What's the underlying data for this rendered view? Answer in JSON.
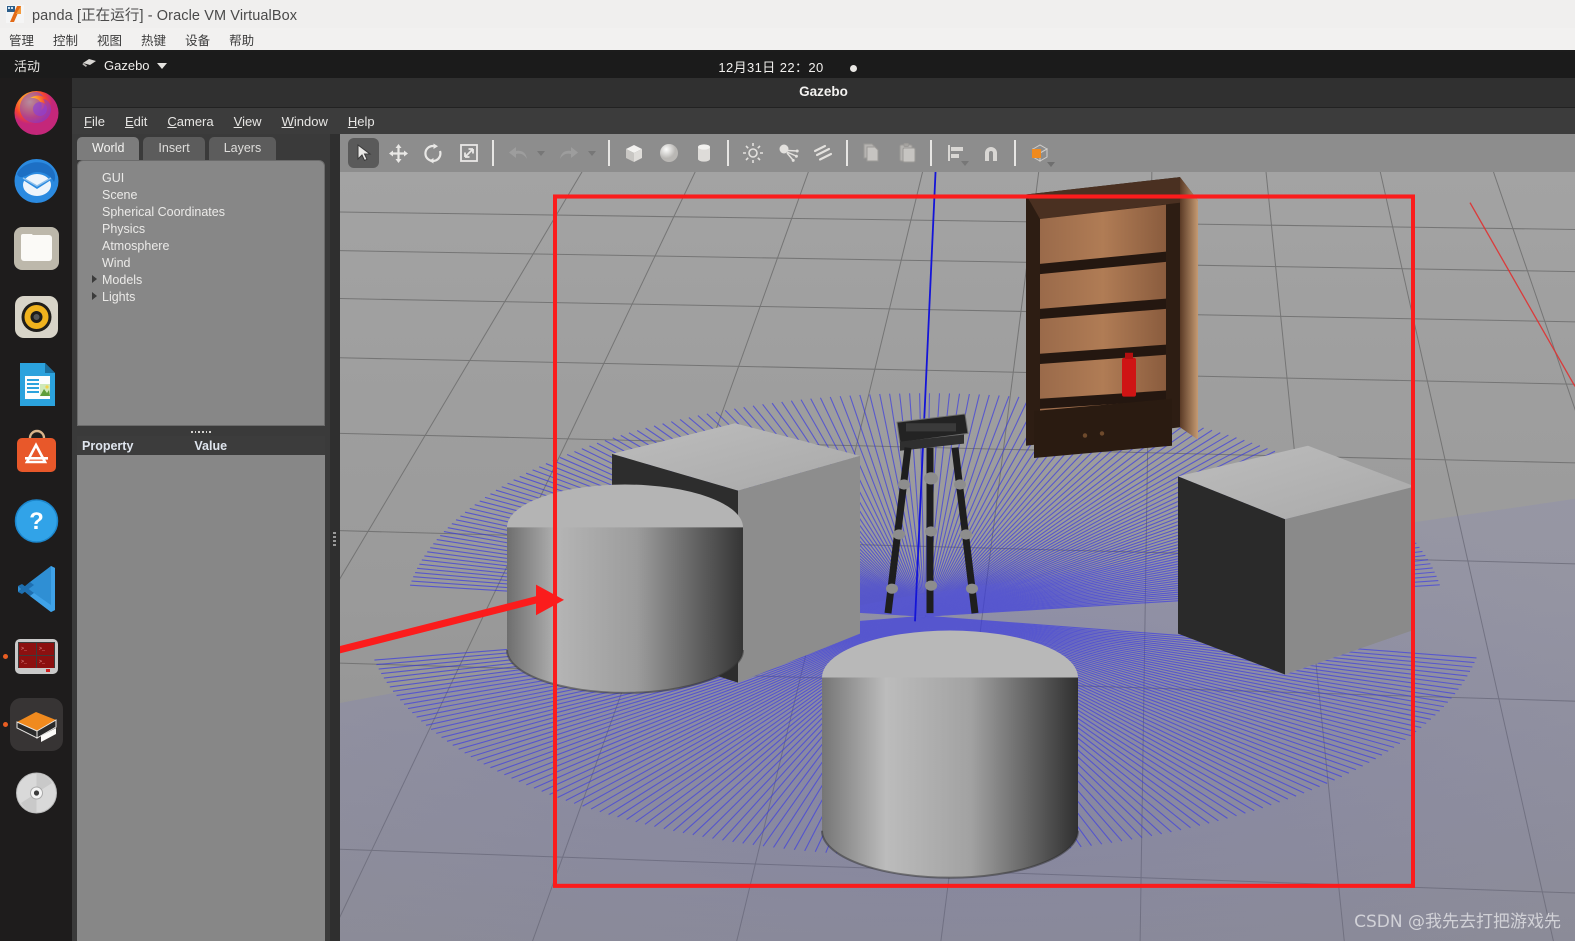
{
  "host_window": {
    "title": "panda [正在运行] - Oracle VM VirtualBox",
    "icon": "virtualbox-icon",
    "menus": [
      "管理",
      "控制",
      "视图",
      "热键",
      "设备",
      "帮助"
    ]
  },
  "shell": {
    "activities": "活动",
    "app_menu_label": "Gazebo",
    "app_menu_icon": "gazebo-icon",
    "clock": "12月31日  22：20",
    "dock": [
      {
        "name": "firefox",
        "label": "Firefox",
        "active": false
      },
      {
        "name": "thunderbird",
        "label": "Thunderbird",
        "active": false
      },
      {
        "name": "files",
        "label": "Files",
        "active": false
      },
      {
        "name": "rhythmbox",
        "label": "Rhythmbox",
        "active": false
      },
      {
        "name": "libreoffice-writer",
        "label": "LibreOffice Writer",
        "active": false
      },
      {
        "name": "ubuntu-software",
        "label": "Ubuntu Software",
        "active": false
      },
      {
        "name": "help",
        "label": "Help",
        "active": false
      },
      {
        "name": "vscode",
        "label": "Visual Studio Code",
        "active": false
      },
      {
        "name": "terminator",
        "label": "Terminator",
        "active": true
      },
      {
        "name": "gazebo",
        "label": "Gazebo",
        "active": true
      },
      {
        "name": "disc",
        "label": "Disc Image",
        "active": false
      }
    ]
  },
  "gazebo": {
    "title": "Gazebo",
    "menus": [
      {
        "label": "File",
        "accel": "F"
      },
      {
        "label": "Edit",
        "accel": "E"
      },
      {
        "label": "Camera",
        "accel": "C"
      },
      {
        "label": "View",
        "accel": "V"
      },
      {
        "label": "Window",
        "accel": "W"
      },
      {
        "label": "Help",
        "accel": "H"
      }
    ],
    "tabs": [
      {
        "label": "World",
        "active": true
      },
      {
        "label": "Insert",
        "active": false
      },
      {
        "label": "Layers",
        "active": false
      }
    ],
    "tree": [
      {
        "label": "GUI",
        "expandable": false
      },
      {
        "label": "Scene",
        "expandable": false
      },
      {
        "label": "Spherical Coordinates",
        "expandable": false
      },
      {
        "label": "Physics",
        "expandable": false
      },
      {
        "label": "Atmosphere",
        "expandable": false
      },
      {
        "label": "Wind",
        "expandable": false
      },
      {
        "label": "Models",
        "expandable": true
      },
      {
        "label": "Lights",
        "expandable": true
      }
    ],
    "property_table": {
      "columns": [
        "Property",
        "Value"
      ],
      "rows": []
    },
    "toolbar": [
      {
        "name": "select-mode-icon",
        "label": "Selection Mode",
        "selected": true
      },
      {
        "name": "translate-mode-icon",
        "label": "Translation Mode",
        "selected": false
      },
      {
        "name": "rotate-mode-icon",
        "label": "Rotation Mode",
        "selected": false
      },
      {
        "name": "scale-mode-icon",
        "label": "Scale Mode",
        "selected": false
      },
      {
        "name": "undo-icon",
        "label": "Undo",
        "selected": false
      },
      {
        "name": "redo-icon",
        "label": "Redo",
        "selected": false
      },
      {
        "name": "box-icon",
        "label": "Box",
        "selected": false
      },
      {
        "name": "sphere-icon",
        "label": "Sphere",
        "selected": false
      },
      {
        "name": "cylinder-icon",
        "label": "Cylinder",
        "selected": false
      },
      {
        "name": "point-light-icon",
        "label": "Point Light",
        "selected": false
      },
      {
        "name": "spot-light-icon",
        "label": "Spot Light",
        "selected": false
      },
      {
        "name": "directional-light-icon",
        "label": "Directional Light",
        "selected": false
      },
      {
        "name": "copy-icon",
        "label": "Copy",
        "selected": false
      },
      {
        "name": "paste-icon",
        "label": "Paste",
        "selected": false
      },
      {
        "name": "align-icon",
        "label": "Align",
        "selected": false
      },
      {
        "name": "snap-icon",
        "label": "Snap",
        "selected": false
      },
      {
        "name": "view-angle-icon",
        "label": "Change View Angle",
        "selected": false
      }
    ]
  },
  "scene": {
    "description": "Gazebo 3D viewport: grid ground plane, laser scan rays in blue, grey box and cylinder obstacles, wooden bookshelf with red can, robot manipulator at center, red selection bounding box with red annotation arrow",
    "selection_box_color": "#fb1c1c",
    "laser_color": "#3b3be0",
    "annotation_arrow_color": "#fb1c1c",
    "objects": [
      {
        "name": "ground-plane-grid"
      },
      {
        "name": "laser-scan-rays"
      },
      {
        "name": "box-back-left"
      },
      {
        "name": "box-right"
      },
      {
        "name": "cylinder-left"
      },
      {
        "name": "cylinder-front"
      },
      {
        "name": "bookshelf"
      },
      {
        "name": "red-can"
      },
      {
        "name": "robot-manipulator"
      },
      {
        "name": "selection-bounding-box"
      },
      {
        "name": "annotation-arrow"
      }
    ]
  },
  "watermark": "CSDN @我先去打把游戏先"
}
